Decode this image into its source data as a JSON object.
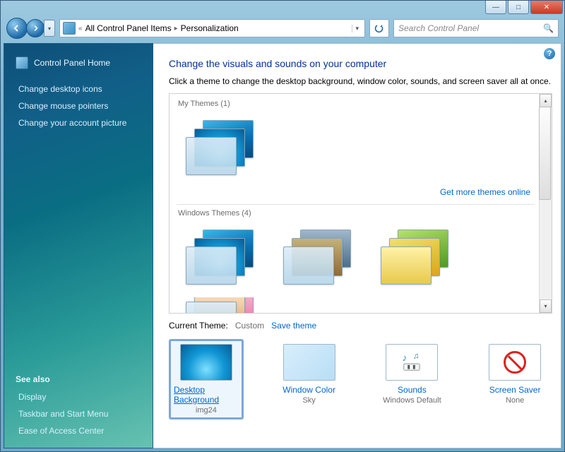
{
  "breadcrumb": {
    "root": "All Control Panel Items",
    "current": "Personalization"
  },
  "search": {
    "placeholder": "Search Control Panel"
  },
  "sidebar": {
    "home": "Control Panel Home",
    "links": [
      "Change desktop icons",
      "Change mouse pointers",
      "Change your account picture"
    ],
    "see_also_hdr": "See also",
    "see_also": [
      "Display",
      "Taskbar and Start Menu",
      "Ease of Access Center"
    ]
  },
  "page": {
    "title": "Change the visuals and sounds on your computer",
    "subtitle": "Click a theme to change the desktop background, window color, sounds, and screen saver all at once.",
    "my_themes_label": "My Themes (1)",
    "more_themes": "Get more themes online",
    "windows_themes_label": "Windows Themes (4)",
    "current_label": "Current Theme:",
    "current_value": "Custom",
    "save_theme": "Save theme"
  },
  "settings": {
    "bg": {
      "title": "Desktop Background",
      "value": "img24"
    },
    "wc": {
      "title": "Window Color",
      "value": "Sky"
    },
    "sd": {
      "title": "Sounds",
      "value": "Windows Default"
    },
    "ss": {
      "title": "Screen Saver",
      "value": "None"
    }
  }
}
